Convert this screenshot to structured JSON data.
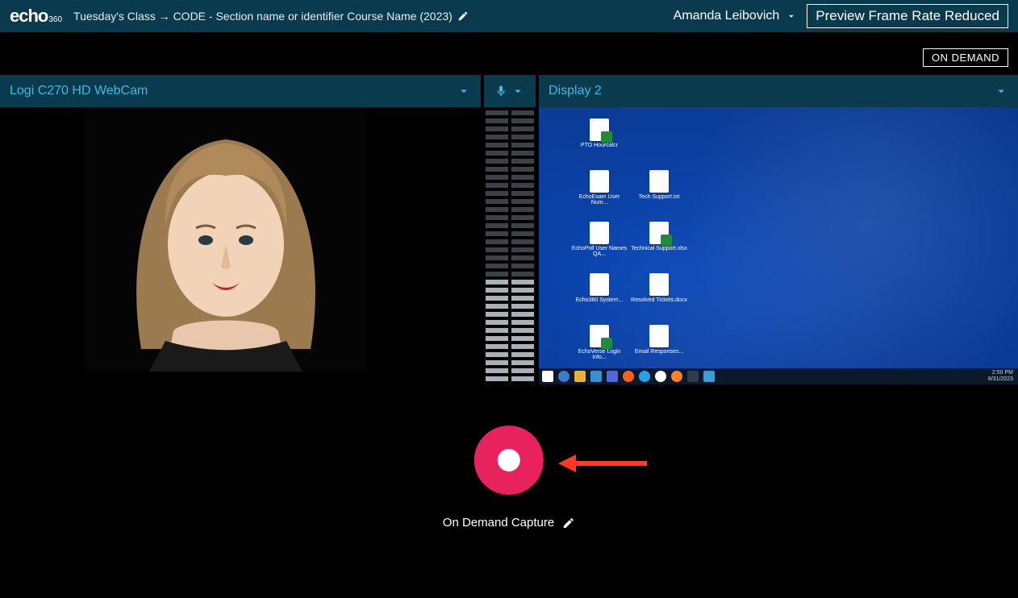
{
  "header": {
    "logo_main": "echo",
    "logo_sub": "360",
    "breadcrumb": "Tuesday's Class → CODE - Section name or identifier Course Name (2023)",
    "user_name": "Amanda Leibovich",
    "framerate_notice": "Preview Frame Rate Reduced"
  },
  "status": {
    "on_demand_badge": "ON DEMAND"
  },
  "sources": {
    "webcam_label": "Logi C270 HD WebCam",
    "display_label": "Display 2"
  },
  "desktop_icons": [
    {
      "label": "PTO Hourcalcr",
      "type": "xls"
    },
    {
      "label": "",
      "type": "none"
    },
    {
      "label": "EchoExam User Num...",
      "type": "doc"
    },
    {
      "label": "Tech Support.txt",
      "type": "doc"
    },
    {
      "label": "EchoPoll User Names QA...",
      "type": "doc"
    },
    {
      "label": "Technical Support.xlsx",
      "type": "xls"
    },
    {
      "label": "Echo360 System...",
      "type": "doc"
    },
    {
      "label": "Resolved Tickets.docx",
      "type": "doc"
    },
    {
      "label": "EchoVerse Login Info...",
      "type": "xls"
    },
    {
      "label": "Email Responses...",
      "type": "doc"
    }
  ],
  "taskbar_time": {
    "time": "2:50 PM",
    "date": "8/31/2023"
  },
  "capture": {
    "label": "On Demand Capture"
  }
}
